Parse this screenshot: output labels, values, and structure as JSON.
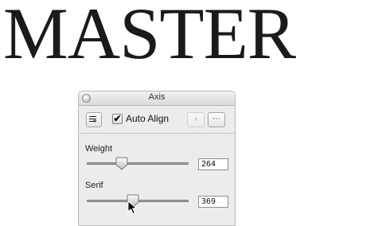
{
  "headline": "MASTER",
  "panel": {
    "title": "Axis",
    "auto_align": {
      "label": "Auto Align",
      "checked": true,
      "check_glyph": "✔"
    },
    "toolbar": {
      "lines_icon": "lines-plus-icon",
      "arrow_glyph": "›",
      "more_glyph": "⋯"
    },
    "axes": [
      {
        "name": "Weight",
        "value": "264",
        "level": 0.34
      },
      {
        "name": "Serif",
        "value": "369",
        "level": 0.45
      }
    ]
  },
  "colors": {
    "headline": "#1a1a1a",
    "panel_bg": "#ececec"
  }
}
